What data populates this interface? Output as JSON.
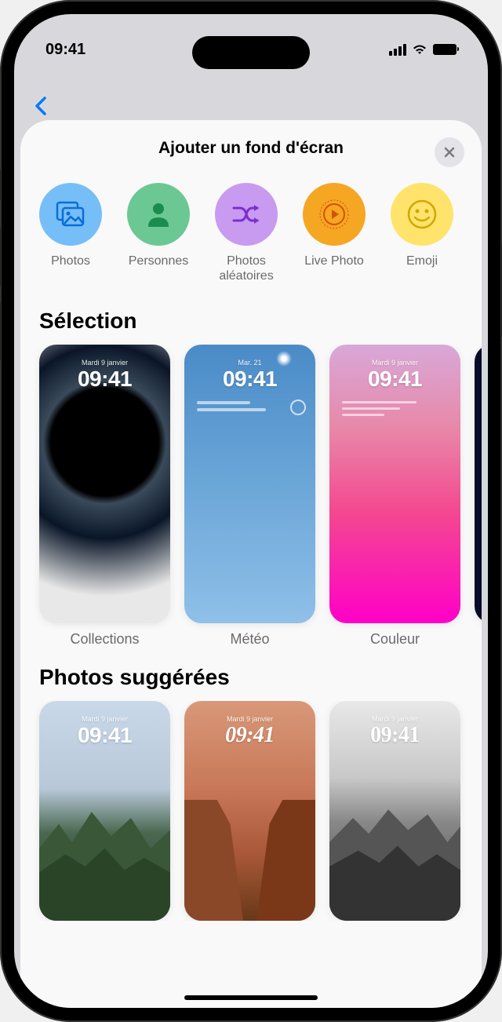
{
  "status": {
    "time": "09:41"
  },
  "sheet": {
    "title": "Ajouter un fond d'écran"
  },
  "categories": [
    {
      "label": "Photos"
    },
    {
      "label": "Personnes"
    },
    {
      "label": "Photos\naléatoires"
    },
    {
      "label": "Live Photo"
    },
    {
      "label": "Emoji"
    }
  ],
  "sections": {
    "selection": {
      "title": "Sélection",
      "items": [
        {
          "date": "Mardi 9 janvier",
          "time": "09:41",
          "label": "Collections"
        },
        {
          "date": "Mar. 21",
          "time": "09:41",
          "label": "Météo"
        },
        {
          "date": "Mardi 9 janvier",
          "time": "09:41",
          "label": "Couleur"
        }
      ]
    },
    "suggested": {
      "title": "Photos suggérées",
      "items": [
        {
          "date": "Mardi 9 janvier",
          "time": "09:41"
        },
        {
          "date": "Mardi 9 janvier",
          "time": "09:41"
        },
        {
          "date": "Mardi 9 janvier",
          "time": "09:41"
        }
      ]
    }
  }
}
